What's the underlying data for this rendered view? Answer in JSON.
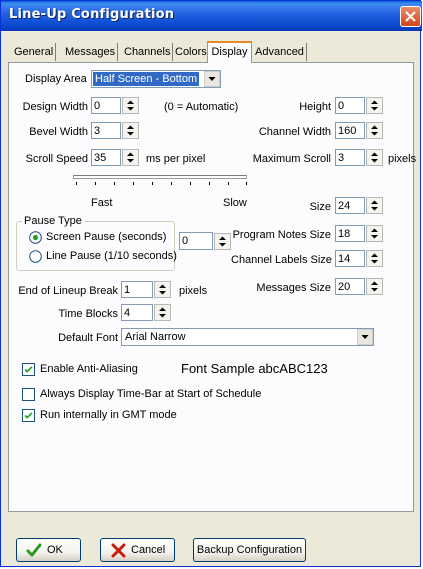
{
  "window": {
    "title": "Line-Up Configuration"
  },
  "tabs": [
    {
      "label": "General"
    },
    {
      "label": "Messages"
    },
    {
      "label": "Channels"
    },
    {
      "label": "Colors"
    },
    {
      "label": "Display",
      "active": true
    },
    {
      "label": "Advanced"
    }
  ],
  "display": {
    "display_area_label": "Display Area",
    "display_area_value": "Half Screen - Bottom",
    "design_width_label": "Design Width",
    "design_width_value": "0",
    "design_width_note": "(0 = Automatic)",
    "height_label": "Height",
    "height_value": "0",
    "bevel_width_label": "Bevel Width",
    "bevel_width_value": "3",
    "channel_width_label": "Channel Width",
    "channel_width_value": "160",
    "scroll_speed_label": "Scroll Speed",
    "scroll_speed_value": "35",
    "scroll_speed_unit": "ms per pixel",
    "maximum_scroll_label": "Maximum Scroll",
    "maximum_scroll_value": "3",
    "maximum_scroll_unit": "pixels",
    "slider_fast_label": "Fast",
    "slider_slow_label": "Slow",
    "size_label": "Size",
    "size_value": "24",
    "pause_type_label": "Pause Type",
    "pause_screen_label": "Screen Pause (seconds)",
    "pause_line_label": "Line Pause (1/10 seconds)",
    "pause_selected": "screen",
    "pause_value": "0",
    "program_notes_size_label": "Program Notes Size",
    "program_notes_size_value": "18",
    "channel_labels_size_label": "Channel Labels Size",
    "channel_labels_size_value": "14",
    "messages_size_label": "Messages Size",
    "messages_size_value": "20",
    "end_of_lineup_break_label": "End of Lineup Break",
    "end_of_lineup_break_value": "1",
    "end_of_lineup_break_unit": "pixels",
    "time_blocks_label": "Time Blocks",
    "time_blocks_value": "4",
    "default_font_label": "Default Font",
    "default_font_value": "Arial Narrow",
    "enable_antialiasing_label": "Enable Anti-Aliasing",
    "enable_antialiasing_checked": true,
    "font_sample_text": "Font Sample abcABC123",
    "always_display_timebar_label": "Always Display Time-Bar at Start of Schedule",
    "always_display_timebar_checked": false,
    "run_gmt_label": "Run internally in GMT mode",
    "run_gmt_checked": true
  },
  "buttons": {
    "ok_label": "OK",
    "cancel_label": "Cancel",
    "backup_label": "Backup Configuration"
  },
  "icons": {
    "ok": "checkmark-icon",
    "cancel": "x-mark-icon",
    "close": "close-icon",
    "spin": "spin-arrows-icon",
    "dropdown": "dropdown-arrow-icon"
  },
  "colors": {
    "titlebar": "#0a4bd0",
    "selection": "#316ac5",
    "ok_check": "#2a9a1c",
    "cancel_x": "#c81d0a",
    "active_tab_accent": "#e68b2c"
  }
}
